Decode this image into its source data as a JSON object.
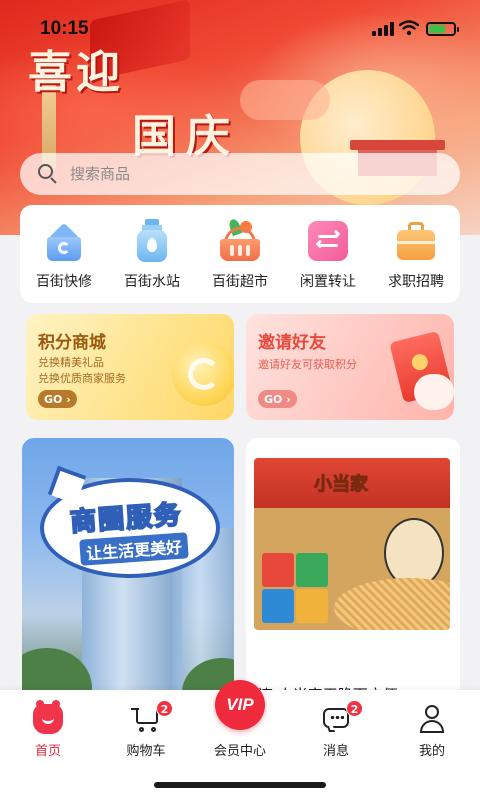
{
  "status_bar": {
    "time": "10:15"
  },
  "banner": {
    "title_line1": "喜迎",
    "title_line2": "国庆"
  },
  "search": {
    "placeholder": "搜索商品"
  },
  "quick_nav": [
    {
      "label": "百街快修",
      "icon": "repair-house-icon"
    },
    {
      "label": "百街水站",
      "icon": "water-bottle-icon"
    },
    {
      "label": "百街超市",
      "icon": "shopping-basket-icon"
    },
    {
      "label": "闲置转让",
      "icon": "exchange-icon"
    },
    {
      "label": "求职招聘",
      "icon": "briefcase-icon"
    }
  ],
  "promos": {
    "points": {
      "title": "积分商城",
      "line1": "兑换精美礼品",
      "line2": "兑换优质商家服务",
      "go": "GO ›"
    },
    "invite": {
      "title": "邀请好友",
      "line1": "邀请好友可获取积分",
      "go": "GO ›"
    }
  },
  "feed": {
    "left": {
      "title": "商圈服务",
      "subtitle": "让生活更美好"
    },
    "right": {
      "brand": "小当家",
      "title": "遼 小当家干脆面方便"
    }
  },
  "tabbar": {
    "home": {
      "label": "首页"
    },
    "cart": {
      "label": "购物车",
      "badge": "2"
    },
    "vip": {
      "label": "会员中心",
      "icon_text": "VIP"
    },
    "messages": {
      "label": "消息",
      "badge": "2"
    },
    "me": {
      "label": "我的"
    }
  },
  "colors": {
    "accent": "#ee2a3c",
    "banner_red": "#e0281e"
  }
}
